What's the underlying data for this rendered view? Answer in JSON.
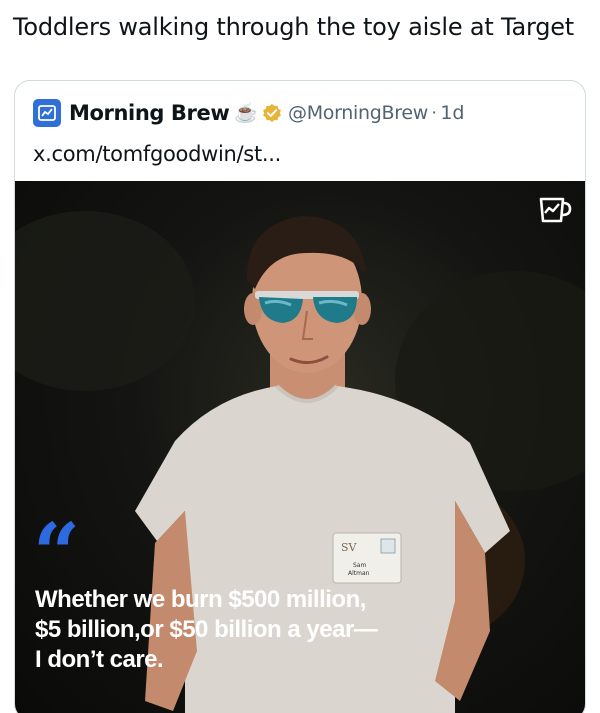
{
  "caption": "Toddlers walking through the toy aisle at Target",
  "quoted_post": {
    "author_name": "Morning Brew",
    "author_emoji": "☕",
    "handle": "@MorningBrew",
    "separator": "·",
    "time": "1d",
    "link_text": "x.com/tomfgoodwin/st...",
    "media": {
      "quote_mark": "“",
      "quote_lines": [
        "Whether we burn $500 million,",
        "$5 billion,or $50 billion a year—",
        "I don’t care."
      ],
      "name_badge": {
        "logo": "SV",
        "first_name": "Sam",
        "last_name": "Altman"
      }
    }
  },
  "colors": {
    "brand_blue": "#2d6ae0",
    "handle_gray": "#536471",
    "verified_gold": "#e8b339"
  }
}
